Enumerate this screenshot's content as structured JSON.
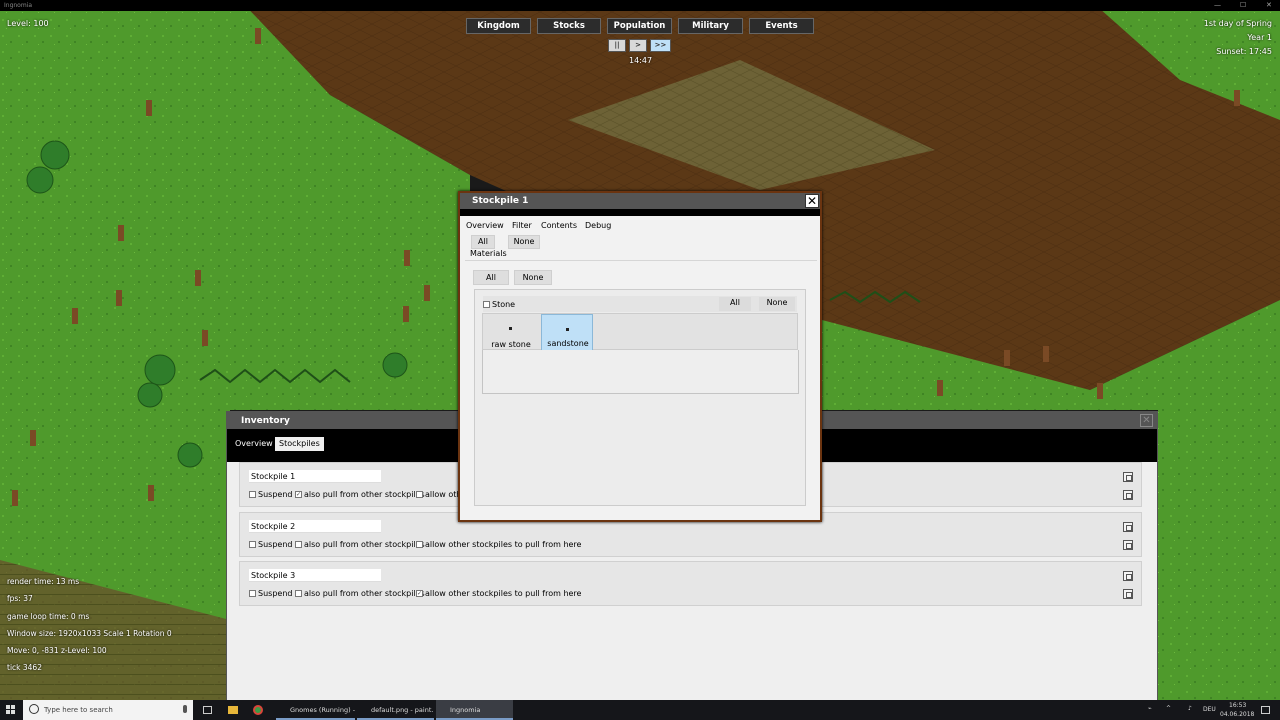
{
  "window": {
    "title": "Ingnomia"
  },
  "hud": {
    "level": "Level: 100",
    "nav": [
      "Kingdom",
      "Stocks",
      "Population",
      "Military",
      "Events"
    ],
    "speed": {
      "pause": "||",
      "play": ">",
      "fast": ">>"
    },
    "time": "14:47",
    "date": {
      "day": "1st day of Spring",
      "year": "Year 1",
      "sunset": "Sunset: 17:45"
    }
  },
  "debug": [
    "render time: 13 ms",
    "fps: 37",
    "game loop time: 0 ms",
    "Window size: 1920x1033 Scale 1 Rotation 0",
    "Move: 0, -831 z-Level: 100",
    "tick 3462"
  ],
  "inventory": {
    "title": "Inventory",
    "tabs": [
      "Overview",
      "Stockpiles"
    ],
    "rows": [
      {
        "name": "Stockpile 1",
        "suspend": "Suspend",
        "suspend_checked": false,
        "pull": "also pull from other stockpiles",
        "pull_checked": true,
        "allow": "allow other stockpiles to pull from here",
        "allow_checked": false
      },
      {
        "name": "Stockpile 2",
        "suspend": "Suspend",
        "suspend_checked": false,
        "pull": "also pull from other stockpiles",
        "pull_checked": false,
        "allow": "allow other stockpiles to pull from here",
        "allow_checked": false
      },
      {
        "name": "Stockpile 3",
        "suspend": "Suspend",
        "suspend_checked": false,
        "pull": "also pull from other stockpiles",
        "pull_checked": false,
        "allow": "allow other stockpiles to pull from here",
        "allow_checked": true
      }
    ]
  },
  "stockpile": {
    "title": "Stockpile 1",
    "close": "✕",
    "tabs": [
      "Overview",
      "Filter",
      "Contents",
      "Debug"
    ],
    "active_tab": "Filter",
    "all": "All",
    "none": "None",
    "materials_label": "Materials",
    "group": {
      "name": "Stone",
      "checked": false,
      "all": "All",
      "none": "None"
    },
    "items": [
      {
        "name": "raw stone",
        "selected": false
      },
      {
        "name": "sandstone",
        "selected": true
      }
    ]
  },
  "taskbar": {
    "search_placeholder": "Type here to search",
    "apps": [
      "Gnomes (Running) -...",
      "default.png - paint...",
      "Ingnomia"
    ],
    "lang": "DEU",
    "clock_time": "16:53",
    "clock_date": "04.06.2018"
  },
  "colors": {
    "grass": "#4f9a2c",
    "dirt": "#5e3a18",
    "accent_border": "#6b3410",
    "selected_item": "#bfe0f7"
  }
}
